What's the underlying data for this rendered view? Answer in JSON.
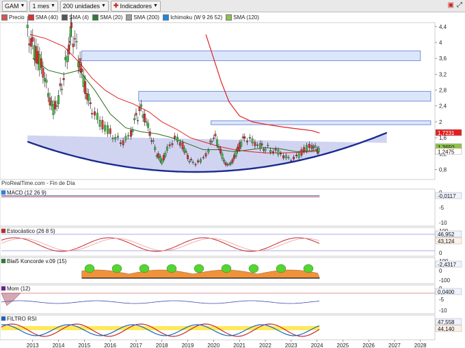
{
  "toolbar": {
    "symbol": "GAM",
    "period": "1 mes",
    "units": "200 unidades",
    "indicators_label": "Indicadores"
  },
  "legend": [
    {
      "label": "Precio",
      "color": "#d9534f"
    },
    {
      "label": "SMA (40)",
      "color": "#e03030"
    },
    {
      "label": "SMA (4)",
      "color": "#555555"
    },
    {
      "label": "SMA (20)",
      "color": "#2e7d32"
    },
    {
      "label": "SMA (200)",
      "color": "#9e9e9e"
    },
    {
      "label": "Ichimoku (W 9 26 52)",
      "color": "#1e88e5"
    },
    {
      "label": "SMA (120)",
      "color": "#8bc34a"
    }
  ],
  "source_label": "ProRealTime.com - Fin de Día",
  "panels": [
    {
      "name": "macd",
      "label": "MACD (12 26 9)",
      "values": [
        "-0,0117"
      ],
      "ticks": [
        "0",
        "-5",
        "-10"
      ]
    },
    {
      "name": "stochastic",
      "label": "Estocástico (26 8 5)",
      "values": [
        "46,952",
        "43,124"
      ],
      "ticks": [
        "100",
        "50",
        "0"
      ]
    },
    {
      "name": "koncorde",
      "label": "Blai5 Koncorde v.09 (15)",
      "values": [
        "-2,4317"
      ],
      "ticks": [
        "100",
        "0",
        "-100"
      ]
    },
    {
      "name": "momentum",
      "label": "Mom (12)",
      "values": [
        "0,0400"
      ],
      "ticks": [
        "0",
        "-5",
        "-10"
      ]
    },
    {
      "name": "rsi-filter",
      "label": "FILTRO RSI",
      "values": [
        "47,558",
        "44,140"
      ],
      "ticks": [
        "50"
      ]
    }
  ],
  "colors": {
    "rect_fill": "#dce6fb",
    "rect_border": "#5b7bd0",
    "channel_fill": "#c9ccee",
    "curve": "#1a2b8f",
    "sma_red": "#e02020",
    "sma_green": "#2f6a1b"
  },
  "chart_data": [
    {
      "type": "candlestick",
      "x": [
        "2013",
        "2014",
        "2015",
        "2016",
        "2017",
        "2018",
        "2019",
        "2020",
        "2021",
        "2022",
        "2023",
        "2024",
        "2025",
        "2026",
        "2027",
        "2028"
      ],
      "y_ticks": [
        "4,4",
        "4",
        "3,6",
        "3,2",
        "2,8",
        "2,4",
        "2",
        "1,6",
        "1,2",
        "0,8"
      ],
      "y_scale": "linear",
      "ylim": [
        0.55,
        4.5
      ],
      "price_labels": [
        "1,7231",
        "1,3650",
        "1,26",
        "1,2475"
      ],
      "resistance_zones": [
        {
          "from": "2014.9",
          "to": "2028.0",
          "y_low": 3.54,
          "y_high": 3.79
        },
        {
          "from": "2017.1",
          "to": "2028.4",
          "y_low": 2.52,
          "y_high": 2.77
        },
        {
          "from": "2019.9",
          "to": "2028.4",
          "y_low": 1.93,
          "y_high": 2.03
        }
      ],
      "close": [
        {
          "x": 2012.8,
          "y": 4.2
        },
        {
          "x": 2013.0,
          "y": 3.9
        },
        {
          "x": 2013.2,
          "y": 3.6
        },
        {
          "x": 2013.4,
          "y": 3.3
        },
        {
          "x": 2013.6,
          "y": 2.7
        },
        {
          "x": 2013.8,
          "y": 2.3
        },
        {
          "x": 2014.0,
          "y": 2.6
        },
        {
          "x": 2014.2,
          "y": 3.2
        },
        {
          "x": 2014.4,
          "y": 3.9
        },
        {
          "x": 2014.5,
          "y": 4.3
        },
        {
          "x": 2014.7,
          "y": 3.8
        },
        {
          "x": 2014.9,
          "y": 3.2
        },
        {
          "x": 2015.1,
          "y": 2.7
        },
        {
          "x": 2015.3,
          "y": 2.3
        },
        {
          "x": 2015.6,
          "y": 2.0
        },
        {
          "x": 2015.9,
          "y": 1.8
        },
        {
          "x": 2016.2,
          "y": 1.6
        },
        {
          "x": 2016.5,
          "y": 1.5
        },
        {
          "x": 2016.8,
          "y": 1.7
        },
        {
          "x": 2017.0,
          "y": 2.1
        },
        {
          "x": 2017.2,
          "y": 2.3
        },
        {
          "x": 2017.4,
          "y": 2.0
        },
        {
          "x": 2017.6,
          "y": 1.6
        },
        {
          "x": 2017.8,
          "y": 1.2
        },
        {
          "x": 2018.0,
          "y": 1.0
        },
        {
          "x": 2018.2,
          "y": 1.3
        },
        {
          "x": 2018.5,
          "y": 1.6
        },
        {
          "x": 2018.8,
          "y": 1.4
        },
        {
          "x": 2019.0,
          "y": 1.1
        },
        {
          "x": 2019.2,
          "y": 0.95
        },
        {
          "x": 2019.5,
          "y": 1.0
        },
        {
          "x": 2019.8,
          "y": 1.3
        },
        {
          "x": 2020.0,
          "y": 1.7
        },
        {
          "x": 2020.2,
          "y": 1.4
        },
        {
          "x": 2020.4,
          "y": 1.0
        },
        {
          "x": 2020.6,
          "y": 0.9
        },
        {
          "x": 2020.8,
          "y": 1.1
        },
        {
          "x": 2021.0,
          "y": 1.4
        },
        {
          "x": 2021.2,
          "y": 1.6
        },
        {
          "x": 2021.5,
          "y": 1.5
        },
        {
          "x": 2021.8,
          "y": 1.4
        },
        {
          "x": 2022.0,
          "y": 1.35
        },
        {
          "x": 2022.3,
          "y": 1.3
        },
        {
          "x": 2022.6,
          "y": 1.2
        },
        {
          "x": 2022.9,
          "y": 1.05
        },
        {
          "x": 2023.2,
          "y": 1.1
        },
        {
          "x": 2023.5,
          "y": 1.3
        },
        {
          "x": 2023.8,
          "y": 1.4
        },
        {
          "x": 2024.0,
          "y": 1.3
        },
        {
          "x": 2024.1,
          "y": 1.26
        }
      ],
      "series": [
        {
          "name": "SMA (40)",
          "color": "#e02020",
          "points": [
            {
              "x": 2012.9,
              "y": 4.2
            },
            {
              "x": 2013.5,
              "y": 4.1
            },
            {
              "x": 2014.2,
              "y": 3.9
            },
            {
              "x": 2014.8,
              "y": 3.5
            },
            {
              "x": 2015.3,
              "y": 3.1
            },
            {
              "x": 2015.8,
              "y": 2.8
            },
            {
              "x": 2016.3,
              "y": 2.6
            },
            {
              "x": 2016.9,
              "y": 2.45
            },
            {
              "x": 2017.5,
              "y": 2.25
            },
            {
              "x": 2018.0,
              "y": 2.0
            },
            {
              "x": 2018.6,
              "y": 1.8
            },
            {
              "x": 2019.1,
              "y": 1.6
            },
            {
              "x": 2019.6,
              "y": 1.5
            },
            {
              "x": 2020.2,
              "y": 1.38
            },
            {
              "x": 2020.8,
              "y": 1.3
            },
            {
              "x": 2021.4,
              "y": 1.25
            },
            {
              "x": 2022.0,
              "y": 1.22
            },
            {
              "x": 2022.6,
              "y": 1.22
            },
            {
              "x": 2023.2,
              "y": 1.23
            },
            {
              "x": 2023.8,
              "y": 1.25
            },
            {
              "x": 2024.1,
              "y": 1.27
            }
          ]
        },
        {
          "name": "SMA (20)",
          "color": "#2f6a1b",
          "points": [
            {
              "x": 2013.0,
              "y": 3.6
            },
            {
              "x": 2013.6,
              "y": 3.3
            },
            {
              "x": 2014.2,
              "y": 3.2
            },
            {
              "x": 2014.8,
              "y": 3.3
            },
            {
              "x": 2015.4,
              "y": 2.8
            },
            {
              "x": 2016.0,
              "y": 2.2
            },
            {
              "x": 2016.6,
              "y": 1.85
            },
            {
              "x": 2017.2,
              "y": 1.75
            },
            {
              "x": 2017.8,
              "y": 1.7
            },
            {
              "x": 2018.4,
              "y": 1.6
            },
            {
              "x": 2019.0,
              "y": 1.45
            },
            {
              "x": 2019.6,
              "y": 1.3
            },
            {
              "x": 2020.2,
              "y": 1.3
            },
            {
              "x": 2020.8,
              "y": 1.25
            },
            {
              "x": 2021.4,
              "y": 1.3
            },
            {
              "x": 2022.0,
              "y": 1.35
            },
            {
              "x": 2022.6,
              "y": 1.32
            },
            {
              "x": 2023.2,
              "y": 1.25
            },
            {
              "x": 2023.8,
              "y": 1.28
            },
            {
              "x": 2024.1,
              "y": 1.3
            }
          ]
        },
        {
          "name": "SMA (120)",
          "color": "#e02020",
          "points": [
            {
              "x": 2019.7,
              "y": 4.2
            },
            {
              "x": 2020.0,
              "y": 3.6
            },
            {
              "x": 2020.3,
              "y": 3.0
            },
            {
              "x": 2020.6,
              "y": 2.5
            },
            {
              "x": 2021.0,
              "y": 2.15
            },
            {
              "x": 2021.5,
              "y": 2.0
            },
            {
              "x": 2022.1,
              "y": 1.93
            },
            {
              "x": 2022.7,
              "y": 1.87
            },
            {
              "x": 2023.3,
              "y": 1.82
            },
            {
              "x": 2023.8,
              "y": 1.78
            },
            {
              "x": 2024.1,
              "y": 1.72
            }
          ]
        }
      ]
    }
  ]
}
